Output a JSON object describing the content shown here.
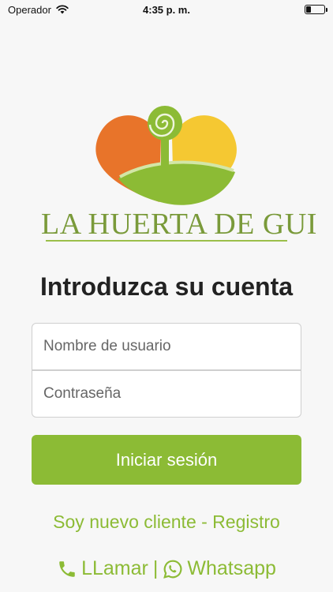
{
  "status_bar": {
    "carrier": "Operador",
    "time": "4:35 p. m.",
    "battery_level": 0.25
  },
  "brand": {
    "name": "LA HUERTA DE GUI",
    "colors": {
      "orange": "#e8742a",
      "yellow": "#f5c832",
      "green": "#8cbb35",
      "text": "#7a9a3a"
    }
  },
  "login": {
    "heading": "Introduzca su cuenta",
    "username_placeholder": "Nombre de usuario",
    "password_placeholder": "Contraseña",
    "submit_label": "Iniciar sesión",
    "register_label": "Soy nuevo cliente - Registro"
  },
  "contact": {
    "call_label": "LLamar",
    "separator": "|",
    "whatsapp_label": "Whatsapp",
    "icons": [
      "phone-icon",
      "whatsapp-icon"
    ]
  }
}
